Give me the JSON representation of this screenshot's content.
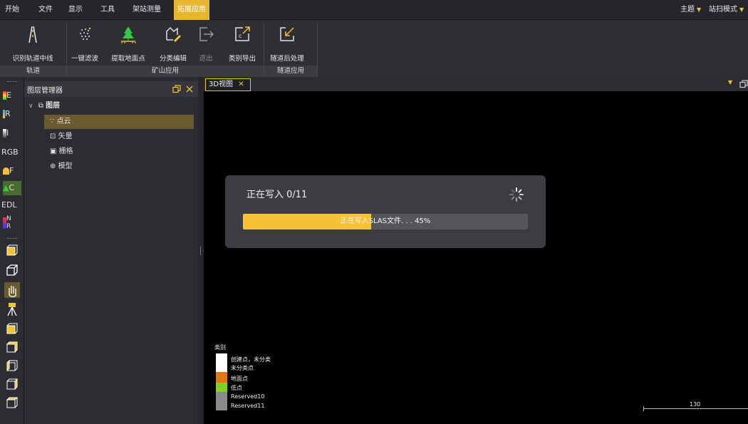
{
  "menubar": {
    "items": [
      "开始",
      "文件",
      "显示",
      "工具",
      "架站测量",
      "拓展应用"
    ],
    "active_index": 5,
    "right": [
      {
        "label": "主题"
      },
      {
        "label": "站扫模式"
      }
    ],
    "caret": "▼"
  },
  "ribbon": {
    "buttons": [
      {
        "label": "识别轨道中线",
        "icon": "track-centerline-icon",
        "enabled": true
      },
      {
        "label": "一键滤波",
        "icon": "filter-dots-icon",
        "enabled": true
      },
      {
        "label": "提取地面点",
        "icon": "ground-points-icon",
        "enabled": true
      },
      {
        "label": "分类编辑",
        "icon": "classify-edit-icon",
        "enabled": true
      },
      {
        "label": "退出",
        "icon": "exit-arrow-icon",
        "enabled": false
      },
      {
        "label": "类别导出",
        "icon": "class-export-icon",
        "enabled": true
      },
      {
        "label": "隧道后处理",
        "icon": "tunnel-postprocess-icon",
        "enabled": true
      }
    ],
    "groups": [
      {
        "label": "轨道"
      },
      {
        "label": "矿山应用"
      },
      {
        "label": "隧道应用"
      }
    ]
  },
  "left_toolbar": {
    "items": [
      {
        "label": "E",
        "icon": "elevation-color-icon"
      },
      {
        "label": "R",
        "icon": "reflectance-icon"
      },
      {
        "label": "I",
        "icon": "intensity-icon"
      },
      {
        "label": "RGB",
        "icon": "rgb-color-icon"
      },
      {
        "label": "F",
        "icon": "feature-icon"
      },
      {
        "label": "C",
        "icon": "classification-icon"
      },
      {
        "label": "EDL",
        "icon": "edl-icon"
      },
      {
        "label": "N R",
        "icon": "normal-render-icon"
      }
    ],
    "view_icons": [
      "perspective-cube-icon",
      "orthographic-cube-icon",
      "pan-hand-icon",
      "station-tripod-icon",
      "view-front-icon",
      "view-back-icon",
      "view-left-icon",
      "view-right-icon",
      "view-top-icon"
    ]
  },
  "layer_panel": {
    "title": "图层管理器",
    "root": "图层",
    "items": [
      {
        "label": "点云",
        "icon": "point-cloud-icon",
        "selected": true
      },
      {
        "label": "矢量",
        "icon": "vector-icon",
        "selected": false
      },
      {
        "label": "栅格",
        "icon": "raster-icon",
        "selected": false
      },
      {
        "label": "模型",
        "icon": "model-icon",
        "selected": false
      }
    ]
  },
  "view": {
    "tab_label": "3D视图",
    "close_glyph": "✕"
  },
  "progress_dialog": {
    "title": "正在写入 0/11",
    "progress_text": "正在写入SLAS文件. . . 45%",
    "progress": 0.45
  },
  "legend": {
    "title": "类别",
    "entries": [
      {
        "label": "创建点，未分类",
        "color": "#ffffff"
      },
      {
        "label": "未分类点",
        "color": "#ffffff"
      },
      {
        "label": "地面点",
        "color": "#e07a10"
      },
      {
        "label": "低点",
        "color": "#7ed321"
      },
      {
        "label": "Reserved10",
        "color": "#8a8a8a"
      },
      {
        "label": "Reserved11",
        "color": "#8a8a8a"
      }
    ]
  },
  "scale_bar": {
    "label": "130"
  },
  "colors": {
    "accent": "#f4c233",
    "menu_active": "#e7b62e"
  }
}
